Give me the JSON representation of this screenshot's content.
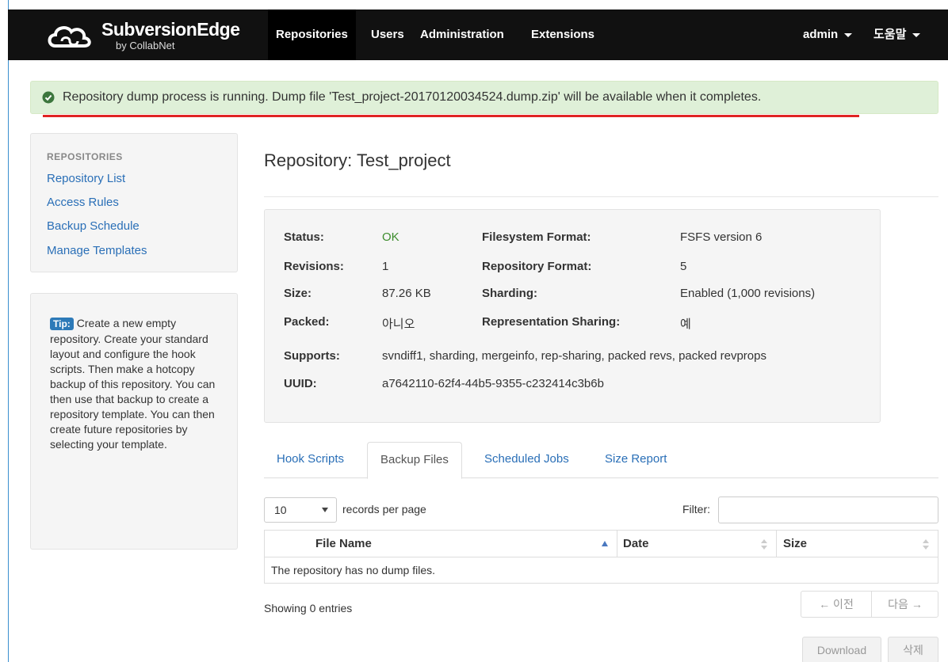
{
  "navbar": {
    "logo_name": "SubversionEdge",
    "logo_sub": "by CollabNet",
    "links": [
      {
        "label": "Repositories",
        "active": true
      },
      {
        "label": "Users",
        "active": false
      },
      {
        "label": "Administration",
        "active": false
      },
      {
        "label": "Extensions",
        "active": false
      }
    ],
    "user_menu": "admin",
    "help_menu": "도움말"
  },
  "alert": {
    "message": "Repository dump process is running. Dump file 'Test_project-20170120034524.dump.zip' will be available when it completes.",
    "color": "#dff0d8"
  },
  "sidebar": {
    "heading": "REPOSITORIES",
    "items": [
      {
        "label": "Repository List"
      },
      {
        "label": "Access Rules"
      },
      {
        "label": "Backup Schedule"
      },
      {
        "label": "Manage Templates"
      }
    ],
    "tip_badge": "Tip:",
    "tip_text": "Create a new empty repository. Create your standard layout and configure the hook scripts. Then make a hotcopy backup of this repository. You can then use that backup to create a repository template. You can then create future repositories by selecting your template."
  },
  "main": {
    "title": "Repository: Test_project",
    "info": {
      "status_label": "Status:",
      "status_value": "OK",
      "revisions_label": "Revisions:",
      "revisions_value": "1",
      "size_label": "Size:",
      "size_value": "87.26 KB",
      "packed_label": "Packed:",
      "packed_value": "아니오",
      "supports_label": "Supports:",
      "supports_value": "svndiff1, sharding, mergeinfo, rep-sharing, packed revs, packed revprops",
      "uuid_label": "UUID:",
      "uuid_value": "a7642110-62f4-44b5-9355-c232414c3b6b",
      "fsformat_label": "Filesystem Format:",
      "fsformat_value": "FSFS version 6",
      "repoformat_label": "Repository Format:",
      "repoformat_value": "5",
      "sharding_label": "Sharding:",
      "sharding_value": "Enabled (1,000 revisions)",
      "repsharing_label": "Representation Sharing:",
      "repsharing_value": "예"
    },
    "tabs": [
      {
        "label": "Hook Scripts",
        "active": false
      },
      {
        "label": "Backup Files",
        "active": true
      },
      {
        "label": "Scheduled Jobs",
        "active": false
      },
      {
        "label": "Size Report",
        "active": false
      }
    ],
    "page_size": "10",
    "records_label": "records per page",
    "filter_label": "Filter:",
    "filter_value": "",
    "table": {
      "columns": [
        "File Name",
        "Date",
        "Size"
      ],
      "empty_message": "The repository has no dump files."
    },
    "showing": "Showing 0 entries",
    "pager_prev": "← 이전",
    "pager_next": "다음 →",
    "download_label": "Download",
    "delete_label": "삭제"
  }
}
